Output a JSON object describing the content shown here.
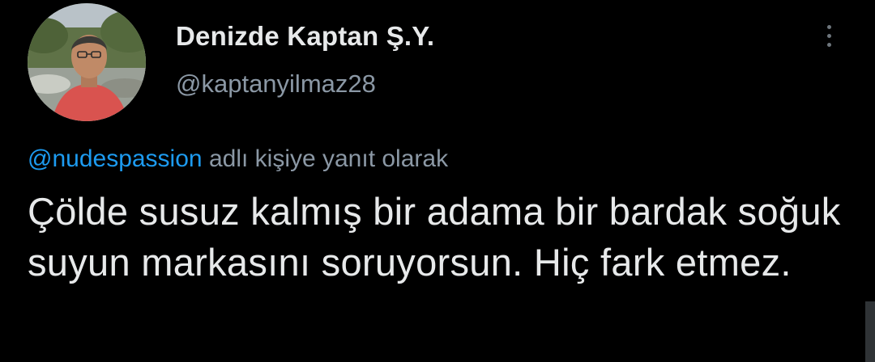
{
  "author": {
    "display_name": "Denizde Kaptan Ş.Y.",
    "username": "@kaptanyilmaz28",
    "avatar_icon": "profile-photo"
  },
  "reply": {
    "mention": "@nudespassion",
    "suffix": " adlı kişiye yanıt olarak"
  },
  "tweet": {
    "text": "Çölde susuz kalmış bir adama bir bardak soğuk suyun markasını soruyorsun. Hiç fark etmez."
  },
  "menu": {
    "more_icon": "more-vertical-icon"
  },
  "colors": {
    "background": "#000000",
    "primary_text": "#e7e9ea",
    "secondary_text": "#8b98a5",
    "link": "#1d9bf0"
  }
}
